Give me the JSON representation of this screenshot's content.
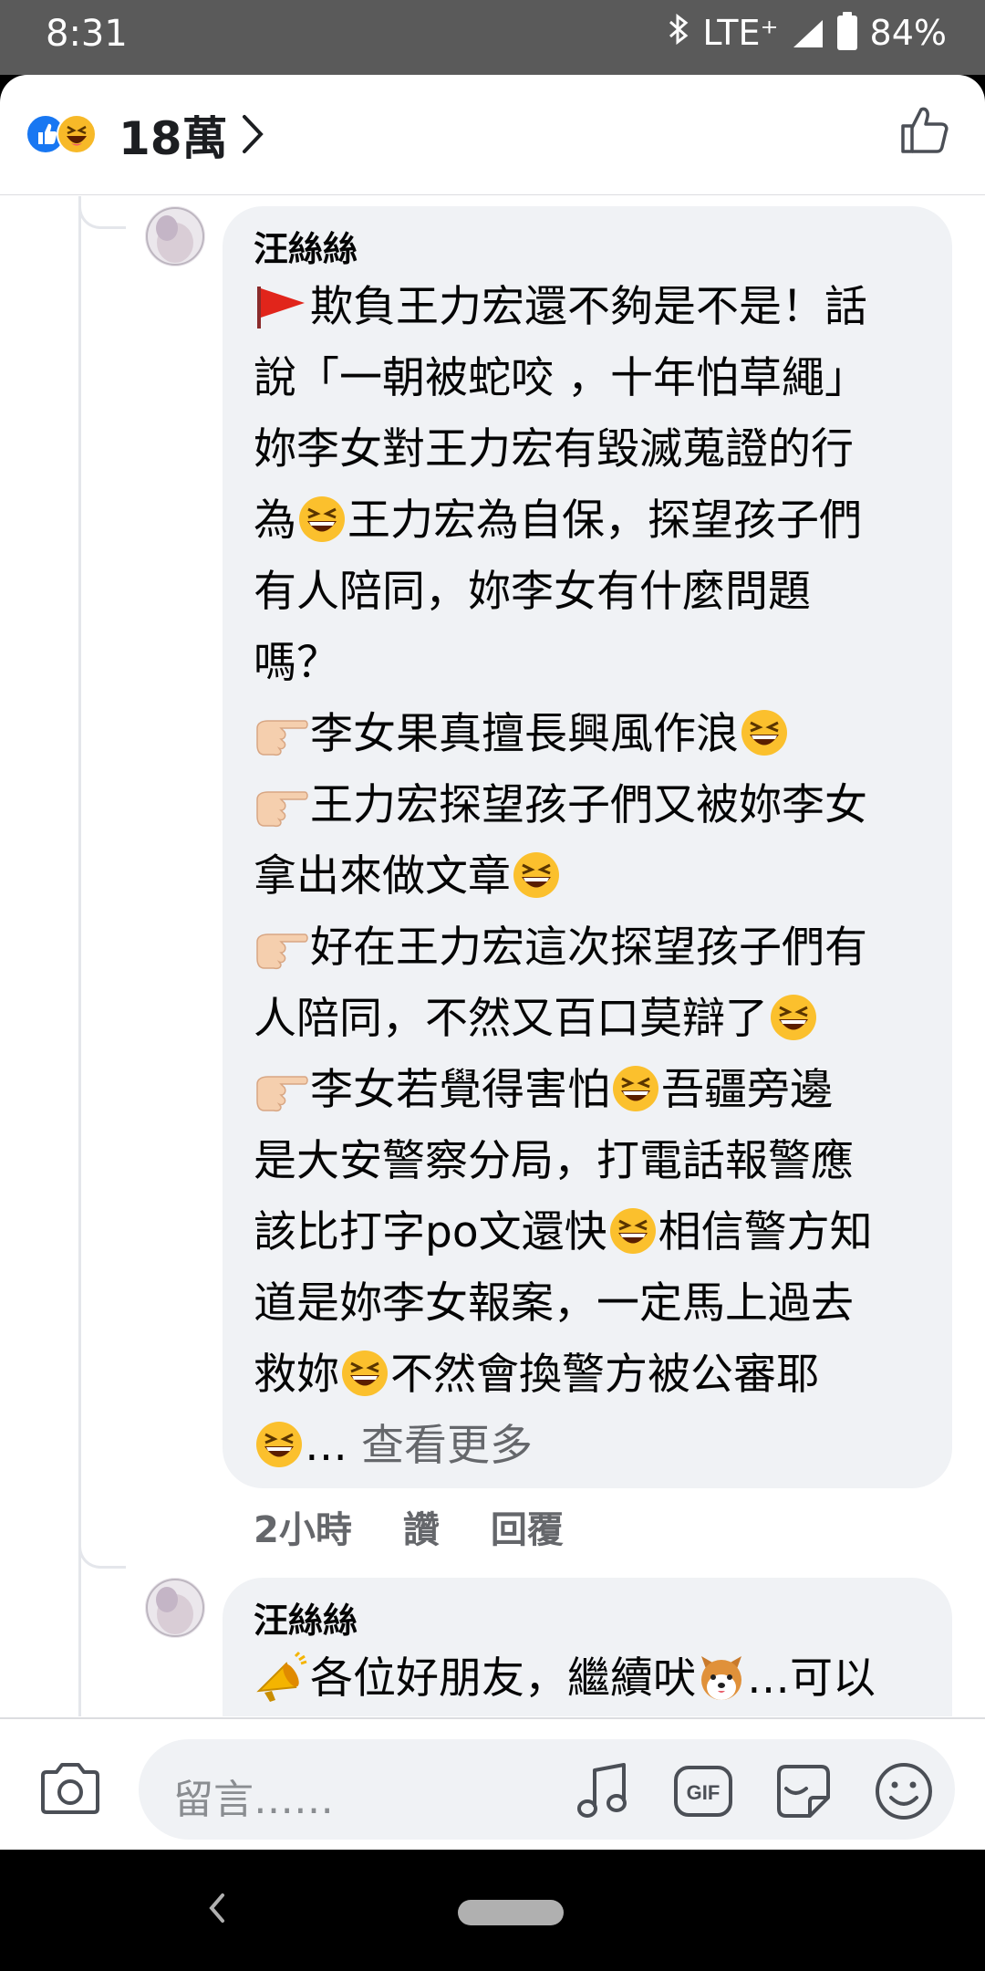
{
  "status_bar": {
    "time": "8:31",
    "network": "LTE⁺",
    "battery": "84%"
  },
  "reactions": {
    "count": "18萬",
    "icons": [
      "like-icon",
      "haha-icon",
      "chevron-right-icon",
      "thumbs-up-icon"
    ]
  },
  "comments": [
    {
      "author": "汪絲絲",
      "lines": [
        "欺負王力宏還不夠是不是！話",
        "說「一朝被蛇咬 ，十年怕草繩」",
        "妳李女對王力宏有毀滅蒐證的行",
        "為",
        "王力宏為自保，探望孩子們",
        "有人陪同，妳李女有什麼問題",
        "嗎？",
        "李女果真擅長興風作浪",
        "王力宏探望孩子們又被妳李女",
        "拿出來做文章",
        "好在王力宏這次探望孩子們有",
        "人陪同，不然又百口莫辯了",
        "李女若覺得害怕",
        "吾疆旁邊",
        "是大安警察分局，打電話報警應",
        "該比打字po文還快",
        "相信警方知",
        "道是妳李女報案，一定馬上過去",
        "救妳",
        "不然會換警方被公審耶",
        "…",
        "查看更多"
      ],
      "time": "2小時",
      "like_label": "讚",
      "reply_label": "回覆"
    },
    {
      "author": "汪絲絲",
      "lines": [
        "各位好朋友，繼續吠",
        "…可以"
      ]
    }
  ],
  "composer": {
    "placeholder": "留言……",
    "gif_label": "GIF"
  }
}
